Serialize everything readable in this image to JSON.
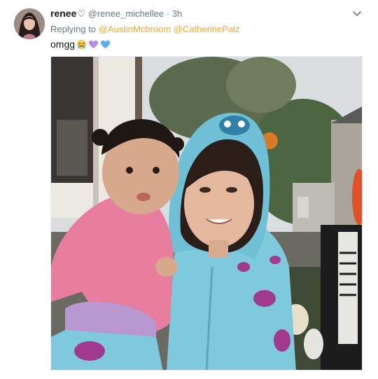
{
  "tweet": {
    "display_name": "renee",
    "name_heart": "♡",
    "handle": "@renee_michellee",
    "separator": "·",
    "time": "3h",
    "replying_label": "Replying to",
    "mentions": [
      "@AustinMcbroom",
      "@CatherinePaiz"
    ],
    "text": "omgg",
    "emojis": [
      "crying-face-emoji",
      "purple-heart-emoji",
      "blue-heart-emoji"
    ],
    "photo_alt": ""
  },
  "colors": {
    "mention": "#f5a623",
    "secondary_text": "#657786",
    "primary_text": "#14171a",
    "hoodie": "#7ec9dc",
    "spots": "#a13a8e"
  }
}
